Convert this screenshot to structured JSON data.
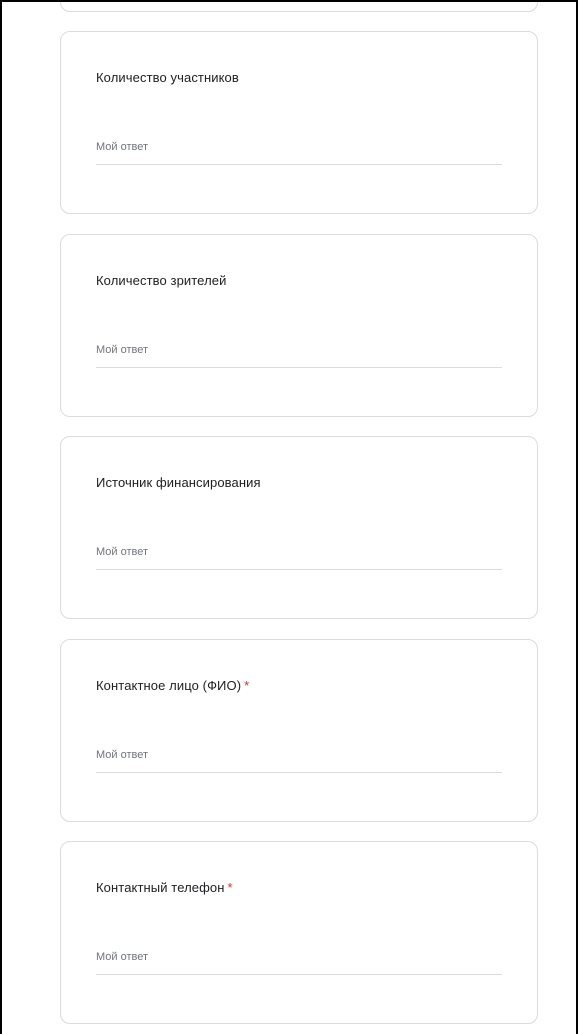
{
  "form": {
    "questions": [
      {
        "title": "Количество участников",
        "required": false,
        "placeholder": "Мой ответ"
      },
      {
        "title": "Количество зрителей",
        "required": false,
        "placeholder": "Мой ответ"
      },
      {
        "title": "Источник финансирования",
        "required": false,
        "placeholder": "Мой ответ"
      },
      {
        "title": "Контактное лицо (ФИО)",
        "required": true,
        "required_mark": "*",
        "placeholder": "Мой ответ"
      },
      {
        "title": "Контактный телефон",
        "required": true,
        "required_mark": "*",
        "placeholder": "Мой ответ"
      }
    ]
  },
  "colors": {
    "required": "#d93025",
    "card_border": "#dadce0",
    "text": "#202124",
    "placeholder": "#70757a"
  }
}
